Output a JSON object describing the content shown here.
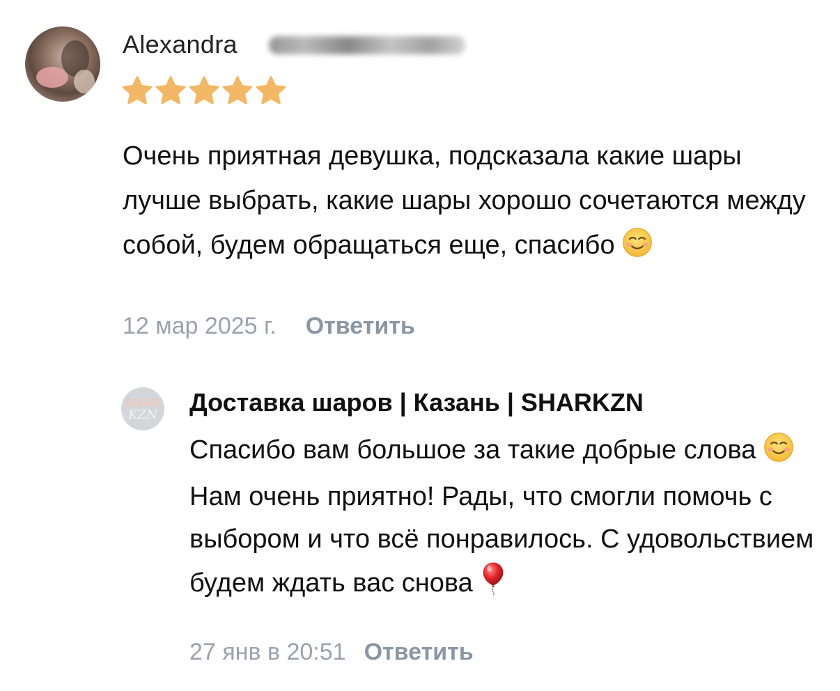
{
  "review": {
    "author": "Alexandra",
    "rating": 5,
    "rating_max": 5,
    "text": "Очень приятная девушка, подсказала какие шары лучше выбрать, какие шары хорошо сочетаются между собой, будем обращаться еще, спасибо",
    "date": "12 мар 2025 г.",
    "reply_label": "Ответить"
  },
  "owner_reply": {
    "name": "Доставка шаров | Казань | SHARKZN",
    "avatar_text_top": "SHAR",
    "avatar_text_bottom": "KZN",
    "text_part1": "Спасибо вам большое за такие добрые слова",
    "text_part2": "Нам очень приятно! Рады, что смогли помочь с выбором и что всё понравилось. С удовольствием будем ждать вас снова",
    "date": "27 янв в 20:51",
    "reply_label": "Ответить"
  },
  "icons": {
    "star": "star-icon",
    "smile": "smiling-face-emoji",
    "balloon": "red-balloon-emoji"
  },
  "colors": {
    "star": "#f3b865",
    "meta_gray": "#9aa3ad",
    "reply_link": "#8a96a3"
  }
}
